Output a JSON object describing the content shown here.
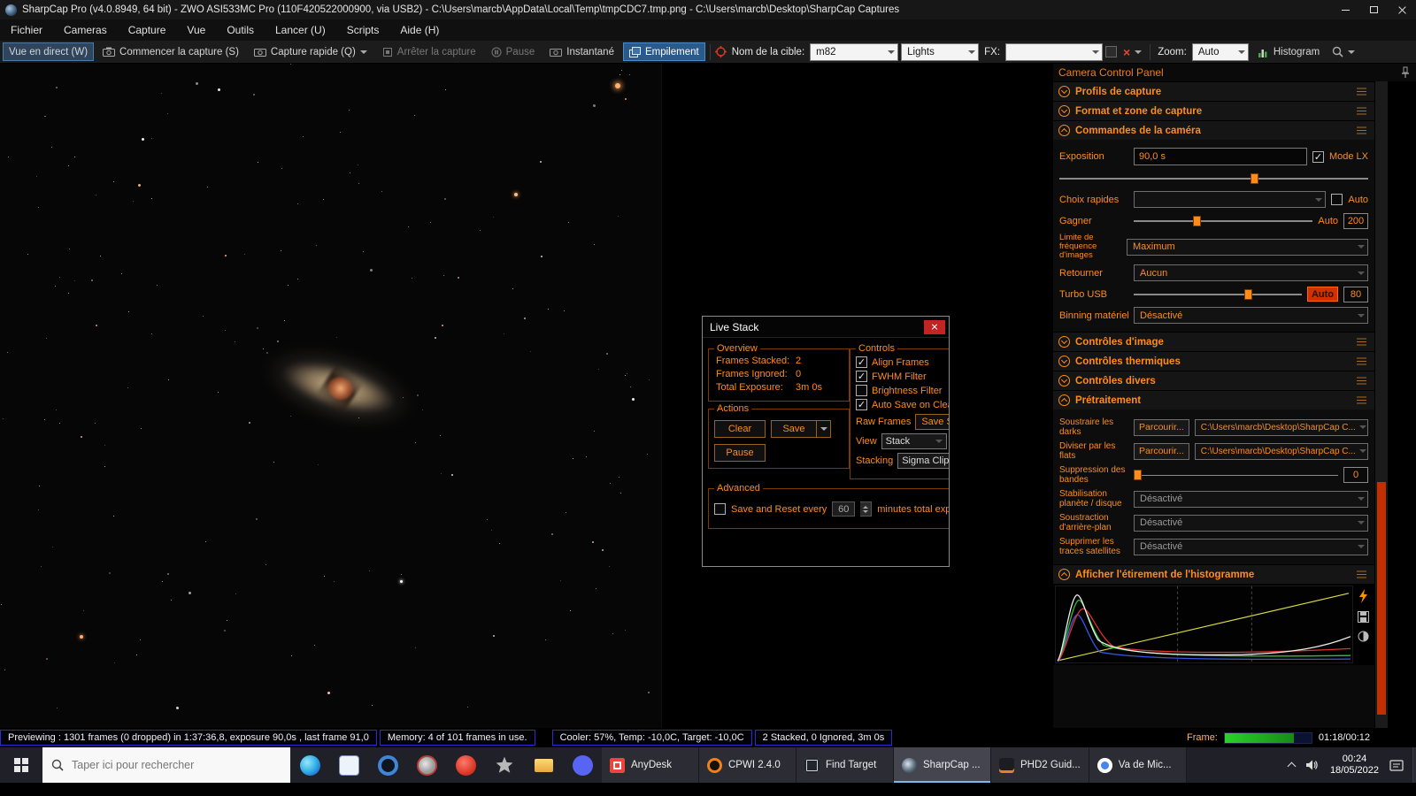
{
  "titlebar": {
    "title": "SharpCap Pro (v4.0.8949, 64 bit) - ZWO ASI533MC Pro (110F420522000900, via USB2) - C:\\Users\\marcb\\AppData\\Local\\Temp\\tmpCDC7.tmp.png - C:\\Users\\marcb\\Desktop\\SharpCap Captures"
  },
  "menubar": {
    "items": [
      {
        "label": "Fichier"
      },
      {
        "label": "Cameras"
      },
      {
        "label": "Capture"
      },
      {
        "label": "Vue"
      },
      {
        "label": "Outils"
      },
      {
        "label": "Lancer (U)"
      },
      {
        "label": "Scripts"
      },
      {
        "label": "Aide (H)"
      }
    ]
  },
  "toolbar": {
    "live_view": "Vue en direct (W)",
    "start_capture": "Commencer la capture (S)",
    "quick_capture": "Capture rapide (Q)",
    "stop_capture": "Arrêter la capture",
    "pause": "Pause",
    "snapshot": "Instantané",
    "stack": "Empilement",
    "target_name_label": "Nom de la cible:",
    "target_name_value": "m82",
    "frame_type_value": "Lights",
    "fx_label": "FX:",
    "fx_value": "",
    "zoom_label": "Zoom:",
    "zoom_value": "Auto",
    "histogram_label": "Histogram"
  },
  "live_stack": {
    "title": "Live Stack",
    "overview": {
      "title": "Overview",
      "rows": [
        {
          "label": "Frames Stacked:",
          "value": "2"
        },
        {
          "label": "Frames Ignored:",
          "value": "0"
        },
        {
          "label": "Total Exposure:",
          "value": "3m 0s"
        }
      ]
    },
    "actions": {
      "title": "Actions",
      "clear": "Clear",
      "save": "Save",
      "pause": "Pause"
    },
    "controls": {
      "title": "Controls",
      "checkboxes": [
        {
          "label": "Align Frames",
          "check": "✓"
        },
        {
          "label": "FWHM Filter",
          "check": "✓"
        },
        {
          "label": "Brightness Filter",
          "check": ""
        },
        {
          "label": "Auto Save on Clea",
          "check": "✓"
        }
      ],
      "raw_frames_label": "Raw Frames",
      "raw_frames_button": "Save St",
      "view_label": "View",
      "view_value": "Stack",
      "stacking_label": "Stacking",
      "stacking_value": "Sigma Clipp"
    },
    "advanced": {
      "title": "Advanced",
      "save_reset_label": "Save and Reset every",
      "save_reset_check": "",
      "minutes_value": "60",
      "minutes_suffix": "minutes total exposu"
    }
  },
  "camera_panel": {
    "title": "Camera Control Panel",
    "sections": {
      "profiles": "Profils de capture",
      "format": "Format et zone de capture",
      "camera_controls": "Commandes de la caméra",
      "image_controls": "Contrôles d'image",
      "thermal_controls": "Contrôles thermiques",
      "misc_controls": "Contrôles divers",
      "preprocessing": "Prétraitement",
      "histogram": "Afficher l'étirement de l'histogramme"
    },
    "camera_controls": {
      "exposure_label": "Exposition",
      "exposure_value": "90,0 s",
      "lx_mode_label": "Mode LX",
      "lx_mode_check": "✓",
      "quick_picks_label": "Choix rapides",
      "quick_picks_auto_label": "Auto",
      "quick_picks_auto_check": "",
      "gain_label": "Gagner",
      "gain_auto_label": "Auto",
      "gain_value": "200",
      "fps_limit_label": "Limite de fréquence d'images",
      "fps_limit_value": "Maximum",
      "flip_label": "Retourner",
      "flip_value": "Aucun",
      "usb_label": "Turbo USB",
      "usb_auto_label": "Auto",
      "usb_value": "80",
      "binning_label": "Binning matériel",
      "binning_value": "Désactivé"
    },
    "preprocessing": {
      "darks_label": "Soustraire les darks",
      "darks_browse": "Parcourir...",
      "darks_path": "C:\\Users\\marcb\\Desktop\\SharpCap C...",
      "flats_label": "Diviser par les flats",
      "flats_browse": "Parcourir...",
      "flats_path": "C:\\Users\\marcb\\Desktop\\SharpCap C...",
      "banding_label": "Suppression des bandes",
      "banding_value": "0",
      "stabilization_label": "Stabilisation planète / disque",
      "stabilization_value": "Désactivé",
      "background_label": "Soustraction d'arrière-plan",
      "background_value": "Désactivé",
      "satellite_label": "Supprimer les traces satellites",
      "satellite_value": "Désactivé"
    }
  },
  "status_bar": {
    "previewing": "Previewing : 1301 frames (0 dropped) in 1:37:36,8, exposure 90,0s , last frame 91,0",
    "memory": "Memory: 4 of 101 frames in use.",
    "cooler": "Cooler: 57%, Temp: -10,0C, Target: -10,0C",
    "stacked": "2 Stacked, 0 Ignored, 3m 0s",
    "frame_label": "Frame:",
    "frame_time": "01:18/00:12"
  },
  "taskbar": {
    "search_placeholder": "Taper ici pour rechercher",
    "apps": [
      {
        "label": "AnyDesk"
      },
      {
        "label": "CPWI 2.4.0"
      },
      {
        "label": "Find Target"
      },
      {
        "label": "SharpCap ..."
      },
      {
        "label": "PHD2 Guid..."
      },
      {
        "label": "Va de Mic..."
      }
    ],
    "clock_time": "00:24",
    "clock_date": "18/05/2022"
  }
}
